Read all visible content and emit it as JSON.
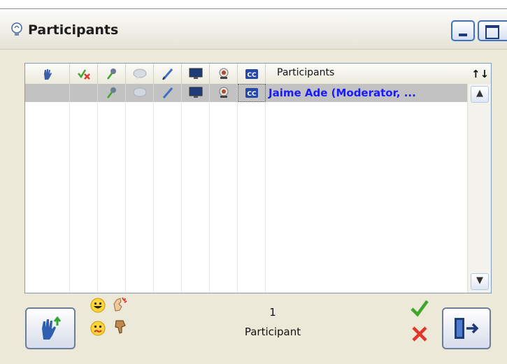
{
  "window": {
    "title": "Participants",
    "title_icon": "lightbulb-icon",
    "minimize_icon": "minimize-icon",
    "maximize_icon": "maximize-icon"
  },
  "grid": {
    "columns": [
      {
        "icon": "raise-hand-icon"
      },
      {
        "icon": "check-x-icon"
      },
      {
        "icon": "microphone-icon"
      },
      {
        "icon": "chat-bubble-icon"
      },
      {
        "icon": "pencil-icon"
      },
      {
        "icon": "monitor-icon"
      },
      {
        "icon": "webcam-icon"
      },
      {
        "icon": "closed-caption-icon"
      }
    ],
    "participants_header": "Participants",
    "sort_icon": "↑↓",
    "rows": [
      {
        "name": "Jaime Ade (Moderator, ..."
      }
    ],
    "scroll_up": "▲",
    "scroll_down": "▼"
  },
  "footer": {
    "participant_count": "1",
    "participant_label": "Participant",
    "raise_hand_button_icon": "raise-hand-up-icon",
    "emoticons": [
      "happy-face-icon",
      "applause-icon",
      "confused-face-icon",
      "thumbs-down-icon"
    ],
    "approve_icon": "green-check-icon",
    "deny_icon": "red-x-icon",
    "exit_button_icon": "exit-door-icon"
  },
  "colors": {
    "accent_blue": "#1a1aff",
    "selected_row": "#c2c2c2",
    "panel_bg": "#ece9d8",
    "check_green": "#3fa52c",
    "x_red": "#e0392b"
  }
}
